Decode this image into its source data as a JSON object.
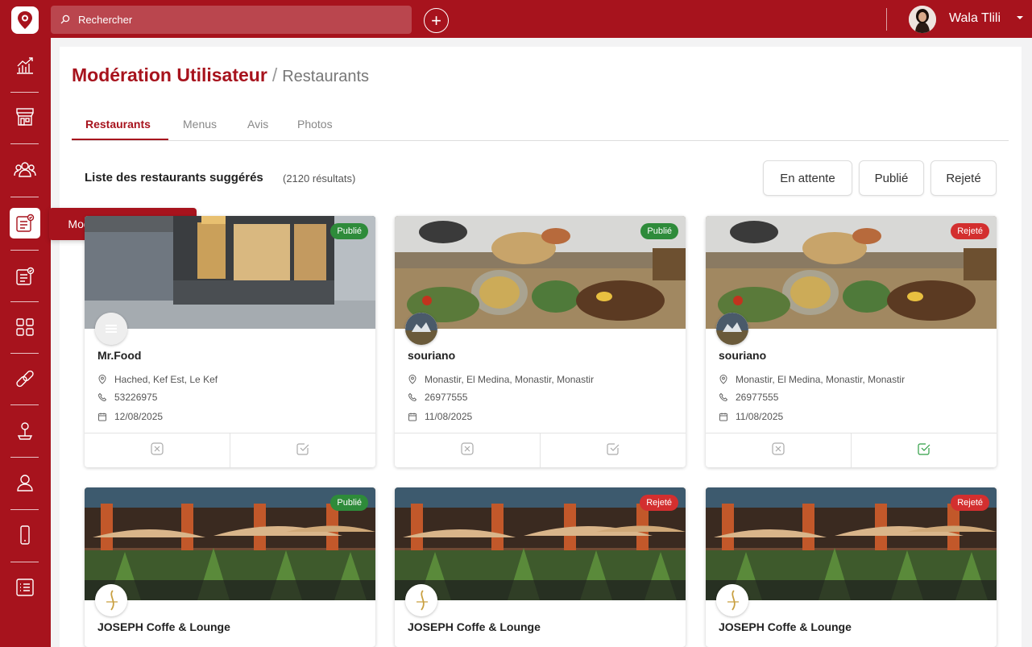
{
  "search": {
    "placeholder": "Rechercher"
  },
  "user": {
    "name": "Wala Tlili"
  },
  "sidebar": {
    "items": [
      "chart-icon",
      "restaurant-icon",
      "users-icon",
      "moderation-icon",
      "moderation-alt-icon",
      "grid-icon",
      "link-icon",
      "pin-icon",
      "profile-icon",
      "mobile-icon",
      "list-icon"
    ],
    "active_tooltip": "Modération Utilisateur"
  },
  "page": {
    "title": "Modération Utilisateur",
    "separator": "/",
    "subtitle": "Restaurants"
  },
  "tabs": [
    "Restaurants",
    "Menus",
    "Avis",
    "Photos"
  ],
  "list": {
    "title": "Liste des restaurants suggérés",
    "count": "(2120 résultats)"
  },
  "filters": [
    "En attente",
    "Publié",
    "Rejeté"
  ],
  "colors": {
    "primary": "#a7131d",
    "publie": "#2e8b3a",
    "rejete": "#d32f2f",
    "approved": "#2e9e44"
  },
  "cards": [
    {
      "name": "Mr.Food",
      "status": "Publié",
      "address": "Hached, Kef Est, Le Kef",
      "phone": "53226975",
      "date": "12/08/2025",
      "approved": false
    },
    {
      "name": "souriano",
      "status": "Publié",
      "address": "Monastir, El Medina, Monastir, Monastir",
      "phone": "26977555",
      "date": "11/08/2025",
      "approved": false
    },
    {
      "name": "souriano",
      "status": "Rejeté",
      "address": "Monastir, El Medina, Monastir, Monastir",
      "phone": "26977555",
      "date": "11/08/2025",
      "approved": true
    },
    {
      "name": "JOSEPH Coffe & Lounge",
      "status": "Publié"
    },
    {
      "name": "JOSEPH Coffe & Lounge",
      "status": "Rejeté"
    },
    {
      "name": "JOSEPH Coffe & Lounge",
      "status": "Rejeté"
    }
  ]
}
